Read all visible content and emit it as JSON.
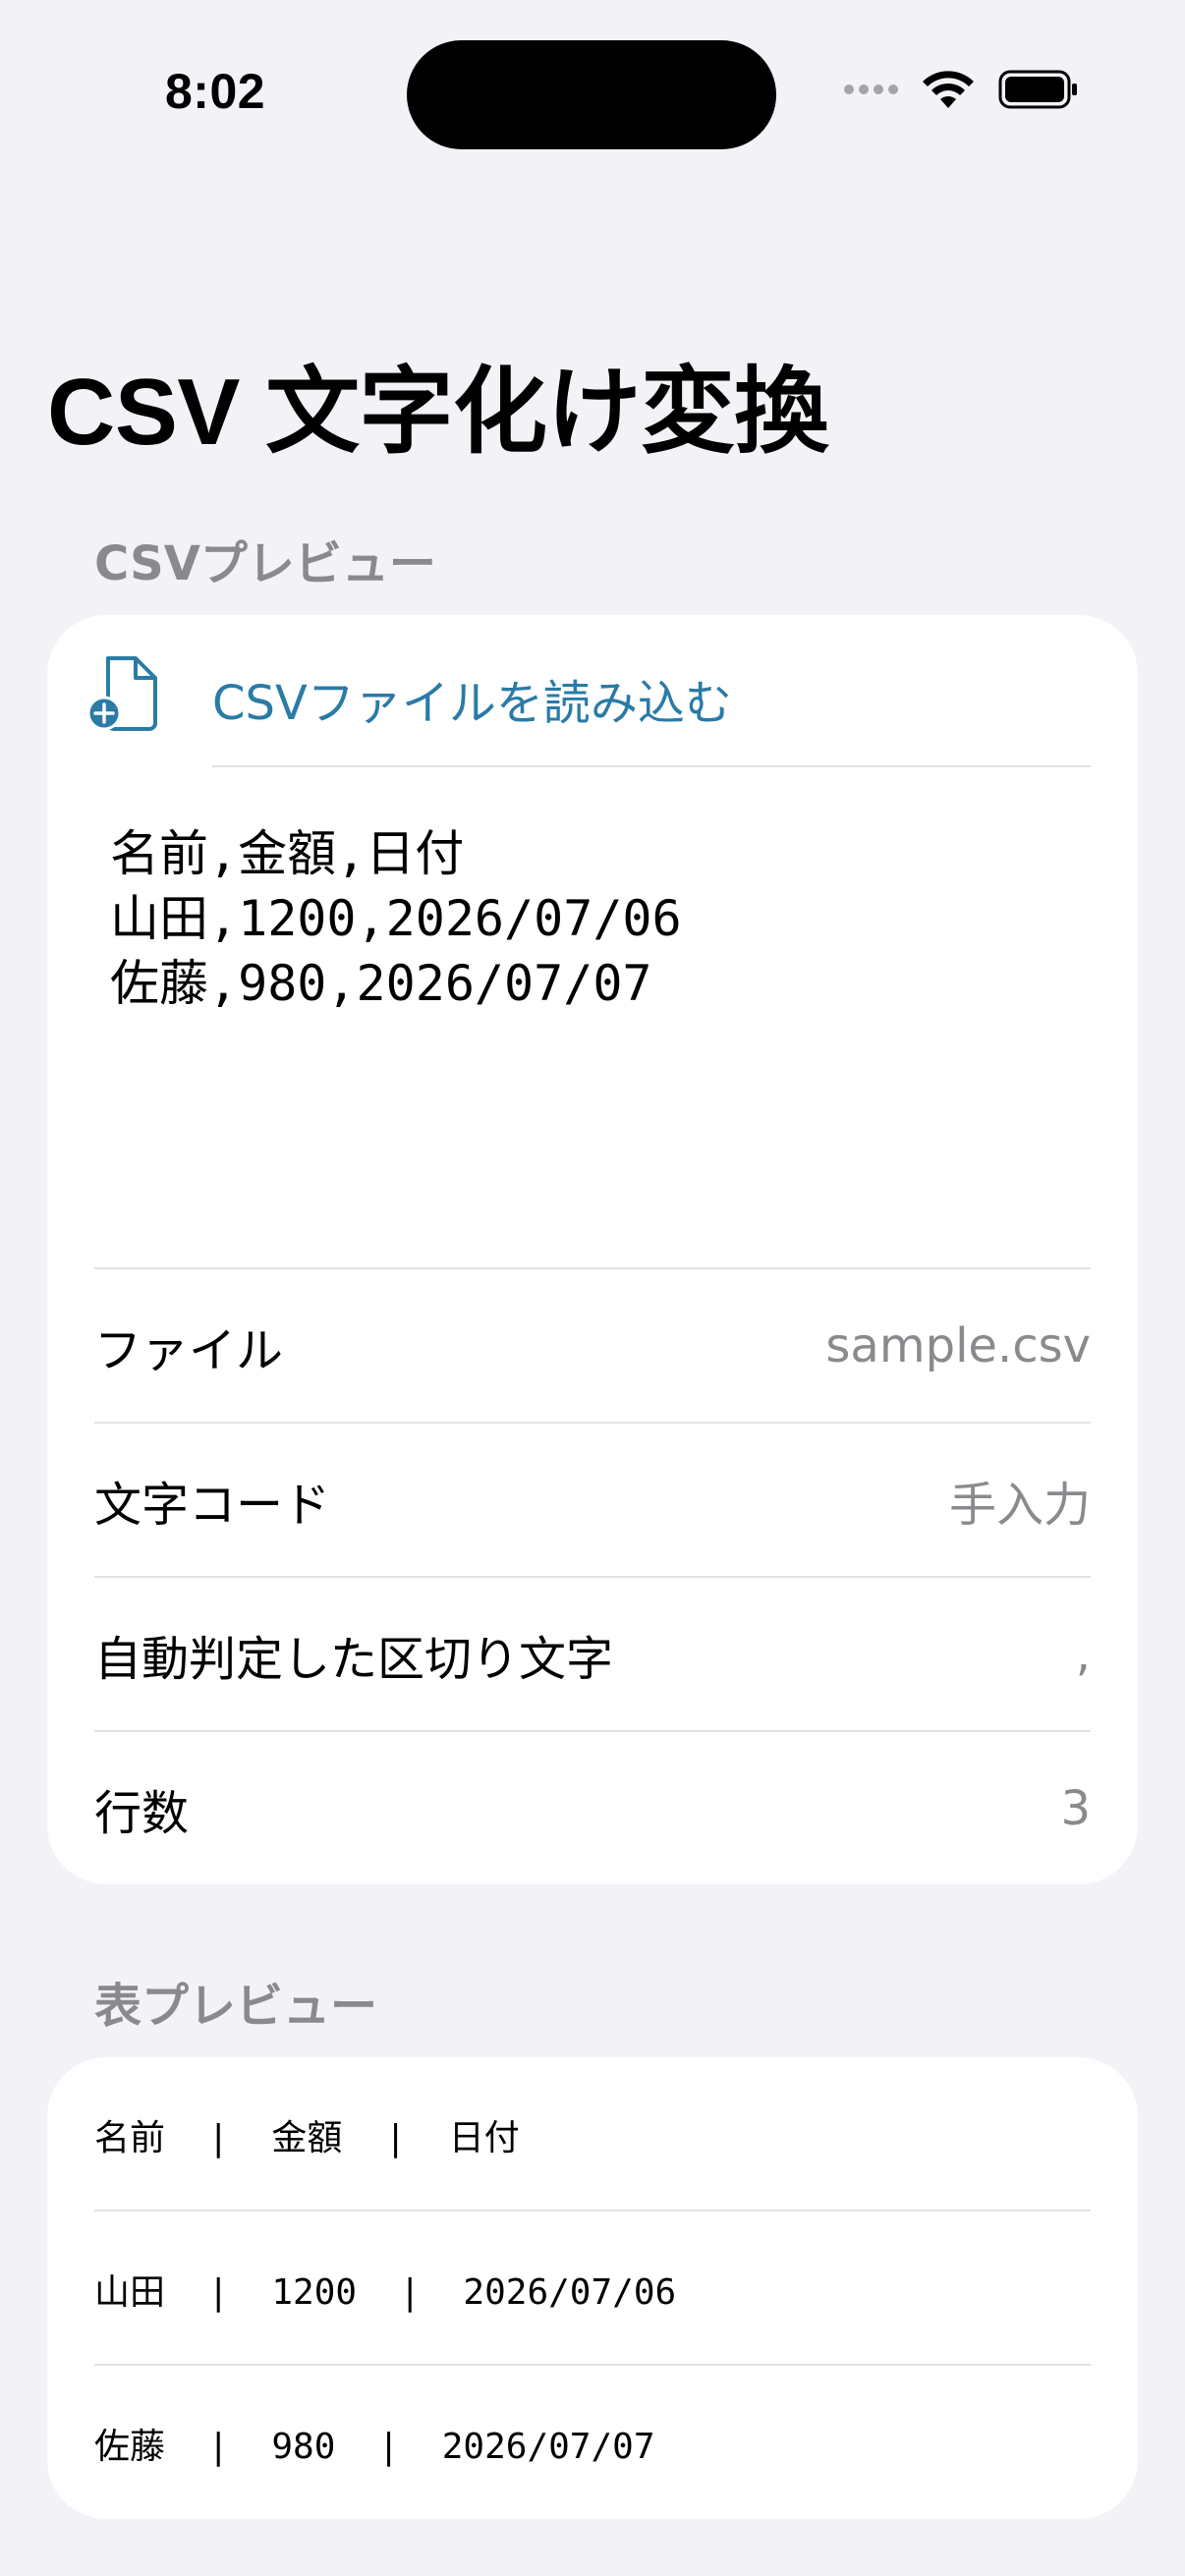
{
  "status_bar": {
    "time": "8:02"
  },
  "title": "CSV 文字化け変換",
  "csv_section": {
    "header": "CSVプレビュー",
    "load_button": "CSVファイルを読み込む",
    "preview_text": "名前,金額,日付\n山田,1200,2026/07/06\n佐藤,980,2026/07/07",
    "info": [
      {
        "label": "ファイル",
        "value": "sample.csv"
      },
      {
        "label": "文字コード",
        "value": "手入力"
      },
      {
        "label": "自動判定した区切り文字",
        "value": ","
      },
      {
        "label": "行数",
        "value": "3"
      }
    ]
  },
  "table_section": {
    "header": "表プレビュー",
    "rows": [
      "名前  |  金額  |  日付",
      "山田  |  1200  |  2026/07/06",
      "佐藤  |  980  |  2026/07/07"
    ]
  },
  "colors": {
    "accent": "#2a7ba6",
    "background": "#f2f2f7",
    "secondary_text": "#8a8a8e"
  },
  "icons": [
    "wifi-icon",
    "battery-icon",
    "document-add-icon"
  ]
}
